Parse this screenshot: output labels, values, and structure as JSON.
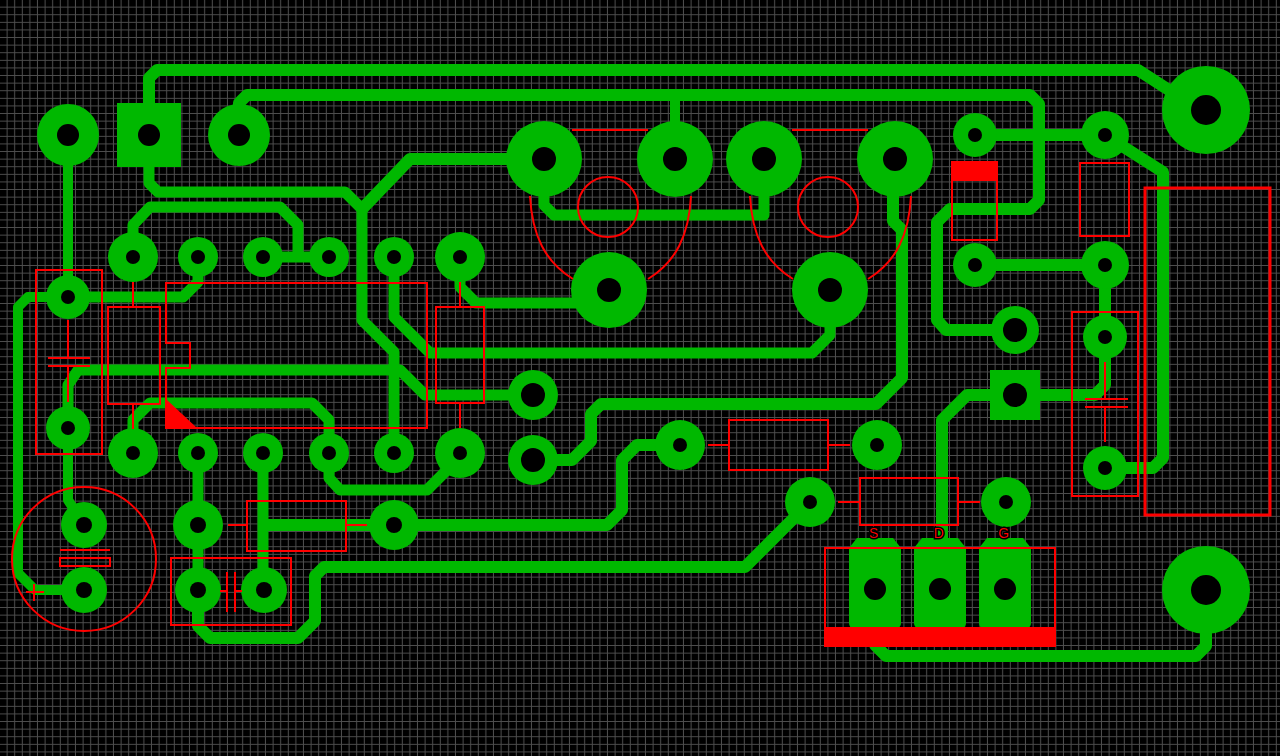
{
  "board": {
    "pin_labels": [
      {
        "text": "S"
      },
      {
        "text": "D"
      },
      {
        "text": "G"
      }
    ]
  }
}
